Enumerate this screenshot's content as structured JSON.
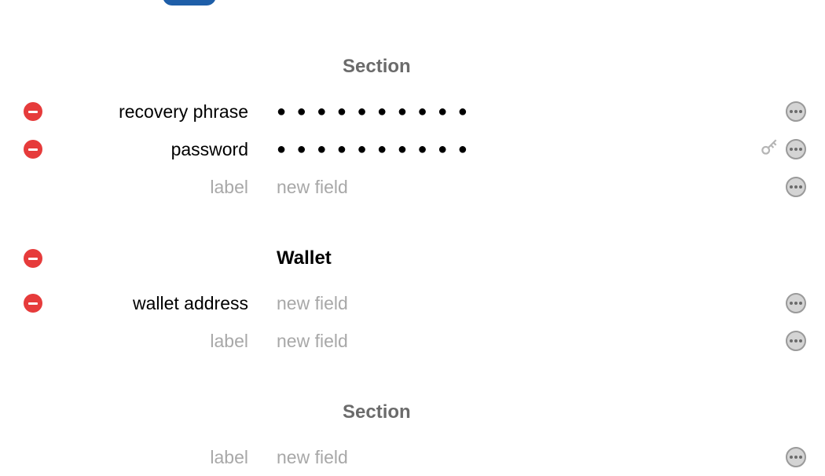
{
  "sections": [
    {
      "title": "Section",
      "title_style": "gray",
      "removable": false,
      "fields": [
        {
          "label": "recovery phrase",
          "label_placeholder": false,
          "value_type": "concealed",
          "dots": "● ● ● ● ● ● ● ● ● ●",
          "removable": true,
          "has_key": false,
          "has_more": true
        },
        {
          "label": "password",
          "label_placeholder": false,
          "value_type": "concealed",
          "dots": "● ● ● ● ● ● ● ● ● ●",
          "removable": true,
          "has_key": true,
          "has_more": true
        },
        {
          "label": "label",
          "label_placeholder": true,
          "value_type": "placeholder",
          "placeholder": "new field",
          "removable": false,
          "has_key": false,
          "has_more": true
        }
      ]
    },
    {
      "title": "Wallet",
      "title_style": "black",
      "removable": true,
      "fields": [
        {
          "label": "wallet address",
          "label_placeholder": false,
          "value_type": "placeholder",
          "placeholder": "new field",
          "removable": true,
          "has_key": false,
          "has_more": true
        },
        {
          "label": "label",
          "label_placeholder": true,
          "value_type": "placeholder",
          "placeholder": "new field",
          "removable": false,
          "has_key": false,
          "has_more": true
        }
      ]
    },
    {
      "title": "Section",
      "title_style": "gray",
      "removable": false,
      "fields": [
        {
          "label": "label",
          "label_placeholder": true,
          "value_type": "placeholder",
          "placeholder": "new field",
          "removable": false,
          "has_key": false,
          "has_more": true
        }
      ]
    }
  ]
}
